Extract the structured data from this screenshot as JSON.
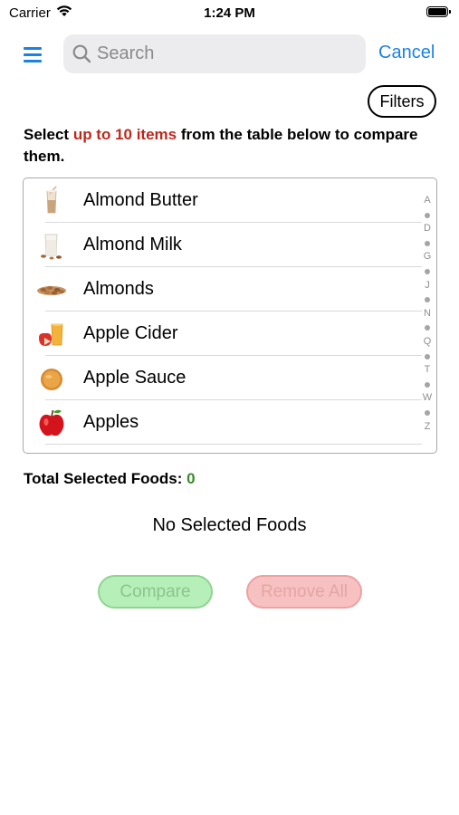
{
  "status_bar": {
    "carrier": "Carrier",
    "time": "1:24 PM"
  },
  "nav": {
    "search_placeholder": "Search",
    "cancel_label": "Cancel"
  },
  "filters_label": "Filters",
  "instructions": {
    "prefix": "Select ",
    "highlight": "up to 10 items",
    "suffix": " from the table below to compare them.",
    "highlight_color": "#c0271b"
  },
  "foods": [
    {
      "name": "Almond Butter",
      "icon": "almond-butter-icon"
    },
    {
      "name": "Almond Milk",
      "icon": "almond-milk-icon"
    },
    {
      "name": "Almonds",
      "icon": "almonds-icon"
    },
    {
      "name": "Apple Cider",
      "icon": "apple-cider-icon"
    },
    {
      "name": "Apple Sauce",
      "icon": "apple-sauce-icon"
    },
    {
      "name": "Apples",
      "icon": "apples-icon"
    }
  ],
  "section_index": [
    "A",
    "•",
    "D",
    "•",
    "G",
    "•",
    "J",
    "•",
    "N",
    "•",
    "Q",
    "•",
    "T",
    "•",
    "W",
    "•",
    "Z"
  ],
  "total": {
    "label": "Total Selected Foods: ",
    "count": "0",
    "count_color": "#3a8a2a"
  },
  "empty_message": "No Selected Foods",
  "buttons": {
    "compare_label": "Compare",
    "remove_all_label": "Remove All"
  },
  "colors": {
    "accent": "#1a82e6",
    "compare_bg": "#b6f0b8",
    "remove_bg": "#f6c1c0"
  }
}
